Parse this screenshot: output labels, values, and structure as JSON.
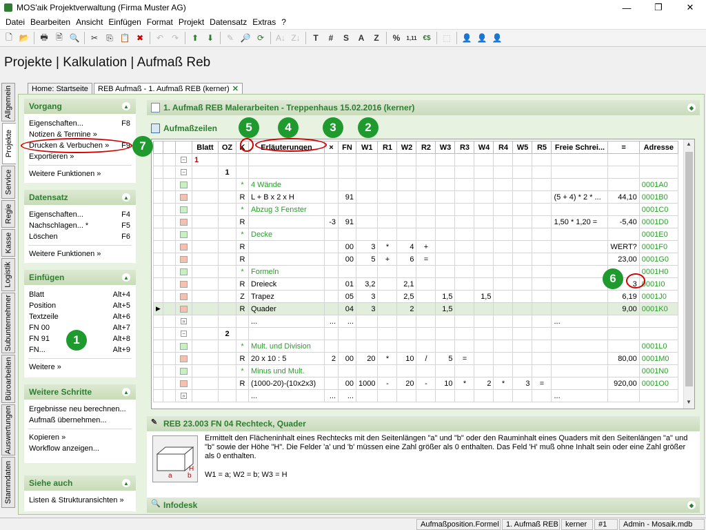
{
  "window": {
    "title": "MOS'aik Projektverwaltung (Firma Muster AG)",
    "minimize": "—",
    "restore": "❐",
    "close": "✕"
  },
  "menu": [
    "Datei",
    "Bearbeiten",
    "Ansicht",
    "Einfügen",
    "Format",
    "Projekt",
    "Datensatz",
    "Extras",
    "?"
  ],
  "toolbar": {
    "g1": [
      "🗋",
      "📂"
    ],
    "g2": [
      "🖶",
      "🖹",
      "🔍"
    ],
    "g3": [
      "✂",
      "⎘",
      "📋",
      "✖"
    ],
    "g4": [
      "↶",
      "↷"
    ],
    "g5": [
      "⬆",
      "⬇"
    ],
    "g6": [
      "✎",
      "🔎",
      "⟳"
    ],
    "g7": [
      "A↓",
      "Z↓"
    ],
    "g8": [
      "T",
      "#",
      "S",
      "A",
      "Z"
    ],
    "g9": [
      "%",
      "1,11",
      "€$"
    ],
    "g10": [
      "⬚"
    ],
    "g11": [
      "👤",
      "👤",
      "👤"
    ]
  },
  "header_title": "Projekte | Kalkulation | Aufmaß Reb",
  "vertical_tabs": [
    "Allgemein",
    "Projekte",
    "Service",
    "Regie",
    "Kasse",
    "Logistik",
    "Subunternehmer",
    "Büroarbeiten",
    "Auswertungen",
    "Stammdaten"
  ],
  "doc_tabs": [
    "Home: Startseite",
    "REB Aufmaß - 1. Aufmaß REB (kerner)"
  ],
  "sidebar": {
    "vorgang": {
      "title": "Vorgang",
      "items": [
        {
          "label": "Eigenschaften...",
          "key": "F8"
        },
        {
          "label": "Notizen & Termine »",
          "key": ""
        },
        {
          "label": "Drucken & Verbuchen »",
          "key": "F9"
        },
        {
          "label": "Exportieren »",
          "key": ""
        }
      ],
      "more": "Weitere Funktionen »"
    },
    "datensatz": {
      "title": "Datensatz",
      "items": [
        {
          "label": "Eigenschaften...",
          "key": "F4"
        },
        {
          "label": "Nachschlagen... *",
          "key": "F5"
        },
        {
          "label": "Löschen",
          "key": "F6"
        }
      ],
      "more": "Weitere Funktionen »"
    },
    "einfuegen": {
      "title": "Einfügen",
      "items": [
        {
          "label": "Blatt",
          "key": "Alt+4"
        },
        {
          "label": "Position",
          "key": "Alt+5"
        },
        {
          "label": "Textzeile",
          "key": "Alt+6"
        },
        {
          "label": "FN 00",
          "key": "Alt+7"
        },
        {
          "label": "FN 91",
          "key": "Alt+8"
        },
        {
          "label": "FN...",
          "key": "Alt+9"
        }
      ],
      "more": "Weitere »"
    },
    "schritte": {
      "title": "Weitere Schritte",
      "items": [
        {
          "label": "Ergebnisse neu berechnen...",
          "key": ""
        },
        {
          "label": "Aufmaß übernehmen...",
          "key": ""
        },
        {
          "label": "Kopieren »",
          "key": ""
        },
        {
          "label": "Workflow anzeigen...",
          "key": ""
        }
      ]
    },
    "siehe": {
      "title": "Siehe auch",
      "items": [
        {
          "label": "Listen & Strukturansichten »",
          "key": ""
        }
      ]
    }
  },
  "main": {
    "doc_header": "1. Aufmaß REB Malerarbeiten - Treppenhaus 15.02.2016 (kerner)",
    "section_title": "Aufmaßzeilen",
    "columns": [
      "",
      "",
      "",
      "Blatt",
      "OZ",
      "K",
      "Erläuterungen",
      "×",
      "FN",
      "W1",
      "R1",
      "W2",
      "R2",
      "W3",
      "R3",
      "W4",
      "R4",
      "W5",
      "R5",
      "Freie Schrei...",
      "=",
      "Adresse"
    ],
    "rows": [
      [
        "",
        "",
        "−",
        "1",
        "",
        "",
        "",
        "",
        "",
        "",
        "",
        "",
        "",
        "",
        "",
        "",
        "",
        "",
        "",
        "",
        "",
        ""
      ],
      [
        "",
        "",
        "−",
        "",
        "1",
        "",
        "",
        "",
        "",
        "",
        "",
        "",
        "",
        "",
        "",
        "",
        "",
        "",
        "",
        "",
        "",
        ""
      ],
      [
        "",
        "",
        "g",
        "",
        "",
        "*",
        "4 Wände",
        "",
        "",
        "",
        "",
        "",
        "",
        "",
        "",
        "",
        "",
        "",
        "",
        "",
        "",
        "0001A0"
      ],
      [
        "",
        "",
        "r",
        "",
        "",
        "R",
        "L + B x 2 x H",
        "",
        "91",
        "",
        "",
        "",
        "",
        "",
        "",
        "",
        "",
        "",
        "",
        "(5 + 4) * 2 * ...",
        "44,10",
        "0001B0"
      ],
      [
        "",
        "",
        "g",
        "",
        "",
        "*",
        "Abzug 3 Fenster",
        "",
        "",
        "",
        "",
        "",
        "",
        "",
        "",
        "",
        "",
        "",
        "",
        "",
        "",
        "0001C0"
      ],
      [
        "",
        "",
        "r",
        "",
        "",
        "R",
        "",
        "-3",
        "91",
        "",
        "",
        "",
        "",
        "",
        "",
        "",
        "",
        "",
        "",
        "1,50 * 1,20 =",
        "-5,40",
        "0001D0"
      ],
      [
        "",
        "",
        "g",
        "",
        "",
        "*",
        "Decke",
        "",
        "",
        "",
        "",
        "",
        "",
        "",
        "",
        "",
        "",
        "",
        "",
        "",
        "",
        "0001E0"
      ],
      [
        "",
        "",
        "r",
        "",
        "",
        "R",
        "",
        "",
        "00",
        "3",
        "*",
        "4",
        "+",
        "",
        "",
        "",
        "",
        "",
        "",
        "",
        "WERT?",
        "0001F0"
      ],
      [
        "",
        "",
        "r",
        "",
        "",
        "R",
        "",
        "",
        "00",
        "5",
        "+",
        "6",
        "=",
        "",
        "",
        "",
        "",
        "",
        "",
        "",
        "23,00",
        "0001G0"
      ],
      [
        "",
        "",
        "g",
        "",
        "",
        "*",
        "Formeln",
        "",
        "",
        "",
        "",
        "",
        "",
        "",
        "",
        "",
        "",
        "",
        "",
        "",
        "",
        "0001H0"
      ],
      [
        "",
        "",
        "r",
        "",
        "",
        "R",
        "Dreieck",
        "",
        "01",
        "3,2",
        "",
        "2,1",
        "",
        "",
        "",
        "",
        "",
        "",
        "",
        "",
        "3",
        "0001I0"
      ],
      [
        "",
        "",
        "r",
        "",
        "",
        "Z",
        "Trapez",
        "",
        "05",
        "3",
        "",
        "2,5",
        "",
        "1,5",
        "",
        "1,5",
        "",
        "",
        "",
        "",
        "6,19",
        "0001J0"
      ],
      [
        "▶",
        "",
        "r",
        "",
        "",
        "R",
        "Quader",
        "",
        "04",
        "3",
        "",
        "2",
        "",
        "1,5",
        "",
        "",
        "",
        "",
        "",
        "",
        "9,00",
        "0001K0"
      ],
      [
        "",
        "",
        "»",
        "",
        "",
        "",
        "...",
        "...",
        "...",
        "",
        "",
        "",
        "",
        "",
        "",
        "",
        "",
        "",
        "",
        "...",
        "",
        ""
      ],
      [
        "",
        "",
        "−",
        "",
        "2",
        "",
        "",
        "",
        "",
        "",
        "",
        "",
        "",
        "",
        "",
        "",
        "",
        "",
        "",
        "",
        "",
        ""
      ],
      [
        "",
        "",
        "g",
        "",
        "",
        "*",
        "Mult. und Division",
        "",
        "",
        "",
        "",
        "",
        "",
        "",
        "",
        "",
        "",
        "",
        "",
        "",
        "",
        "0001L0"
      ],
      [
        "",
        "",
        "r",
        "",
        "",
        "R",
        "20 x 10 : 5",
        "2",
        "00",
        "20",
        "*",
        "10",
        "/",
        "5",
        "=",
        "",
        "",
        "",
        "",
        "",
        "80,00",
        "0001M0"
      ],
      [
        "",
        "",
        "g",
        "",
        "",
        "*",
        "Minus und Mult.",
        "",
        "",
        "",
        "",
        "",
        "",
        "",
        "",
        "",
        "",
        "",
        "",
        "",
        "",
        "0001N0"
      ],
      [
        "",
        "",
        "r",
        "",
        "",
        "R",
        "(1000-20)-(10x2x3)",
        "",
        "00",
        "1000",
        "-",
        "20",
        "-",
        "10",
        "*",
        "2",
        "*",
        "3",
        "=",
        "",
        "920,00",
        "0001O0"
      ],
      [
        "",
        "",
        "»",
        "",
        "",
        "",
        "...",
        "...",
        "...",
        "",
        "",
        "",
        "",
        "",
        "",
        "",
        "",
        "",
        "",
        "...",
        "",
        ""
      ]
    ],
    "desc_title": "REB 23.003 FN 04 Rechteck, Quader",
    "desc_text": "Ermittelt den Flächeninhalt eines Rechtecks mit den Seitenlängen \"a\" und \"b\" oder den Rauminhalt eines Quaders mit den Seitenlängen \"a\" und \"b\" sowie der Höhe \"H\". Die Felder 'a' und 'b' müssen eine Zahl größer als 0 enthalten. Das Feld 'H' muß ohne Inhalt sein oder eine Zahl größer als 0 enthalten.",
    "desc_formula": "W1 = a; W2 = b; W3 = H",
    "desc_labels": {
      "h": "H",
      "a": "a",
      "b": "b"
    },
    "infodesk": "Infodesk"
  },
  "status": [
    "Aufmaßposition.Formel",
    "1. Aufmaß REB",
    "kerner",
    "#1",
    "Admin - Mosaik.mdb"
  ],
  "badges": [
    "1",
    "2",
    "3",
    "4",
    "5",
    "6",
    "7"
  ],
  "colors": {
    "accent": "#2e7d32",
    "badge": "#1e9a2e",
    "marker": "#d00000"
  }
}
